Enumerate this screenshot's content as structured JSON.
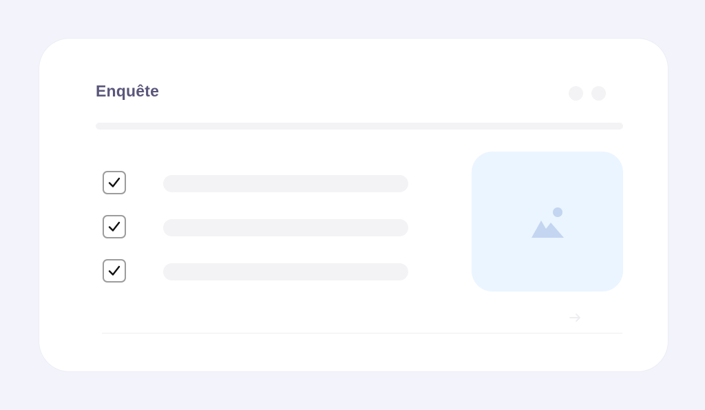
{
  "survey": {
    "title": "Enquête"
  },
  "checklist": {
    "items": [
      {
        "checked": true
      },
      {
        "checked": true
      },
      {
        "checked": true
      }
    ]
  },
  "icons": {
    "window_dots": [
      "dot-icon",
      "dot-icon"
    ],
    "checkbox": "checkmark-icon",
    "image": "image-placeholder-icon",
    "next": "arrow-right-icon"
  },
  "colors": {
    "background": "#f3f4fb",
    "card": "#ffffff",
    "title": "#5a567a",
    "placeholder": "#f3f3f5",
    "image_tile": "#ebf5ff",
    "image_icon": "#c3d5f0",
    "checkbox_border": "#9c9c9c"
  }
}
